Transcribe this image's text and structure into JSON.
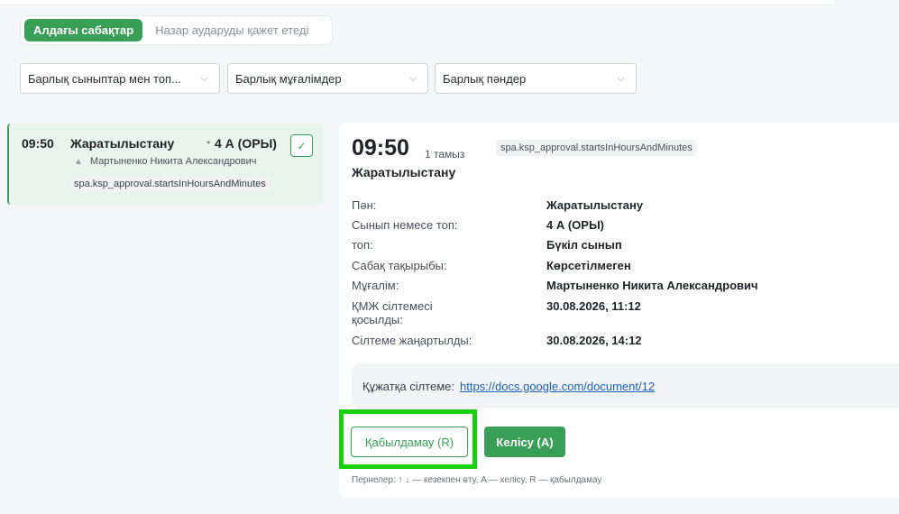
{
  "tabs": {
    "upcoming": "Алдағы сабақтар",
    "attention": "Назар аударуды қажет етеді"
  },
  "filters": {
    "classes": "Барлық сыныптар мен топ...",
    "teachers": "Барлық мұғалімдер",
    "subjects": "Барлық пәндер"
  },
  "lesson": {
    "time": "09:50",
    "subject": "Жаратылыстану",
    "class": "4 А (ОРЫ)",
    "teacher": "Мартыненко Никита Александрович",
    "badge": "spa.ksp_approval.startsInHoursAndMinutes"
  },
  "detail": {
    "time": "09:50",
    "date": "1 тамыз",
    "badge": "spa.ksp_approval.startsInHoursAndMinutes",
    "subject": "Жаратылыстану",
    "rows": [
      {
        "label": "Пән:",
        "value": "Жаратылыстану"
      },
      {
        "label": "Сынып немесе топ:",
        "value": "4 А (ОРЫ)"
      },
      {
        "label": "топ:",
        "value": "Бүкіл сынып"
      },
      {
        "label": "Сабақ тақырыбы:",
        "value": "Көрсетілмеген"
      },
      {
        "label": "Мұғалім:",
        "value": "Мартыненко Никита Александрович"
      },
      {
        "label": "ҚМЖ сілтемесі қосылды:",
        "value": "30.08.2026, 11:12"
      },
      {
        "label": "Сілтеме жаңартылды:",
        "value": "30.08.2026, 14:12"
      }
    ],
    "doc_label": "Құжатқа сілтеме:",
    "doc_link": "https://docs.google.com/document/12",
    "reject_button": "Қабылдамау (R)",
    "approve_button": "Келісу (A)",
    "hint": "Пернелер: ↑ ↓ — кезекпен өту, A — келісу, R — қабылдамау"
  },
  "colors": {
    "accent": "#3a9f56",
    "highlight": "#17d20b",
    "link": "#1a62b5"
  }
}
